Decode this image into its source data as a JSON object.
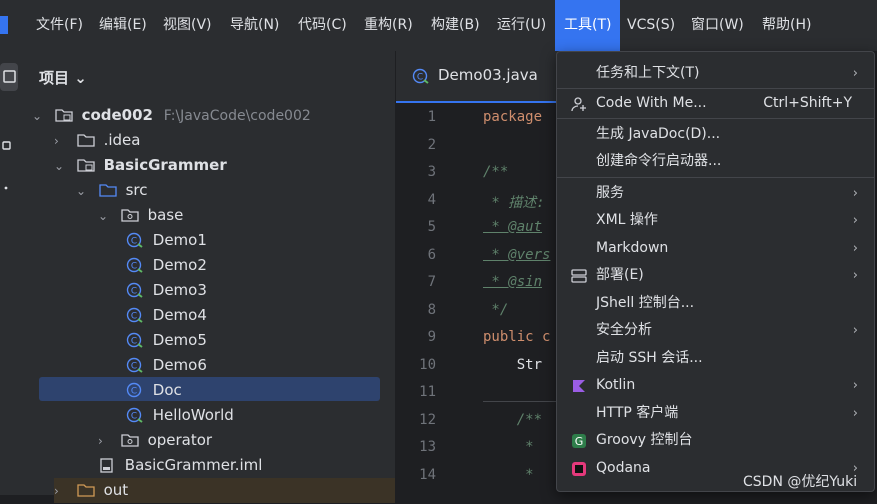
{
  "menubar": {
    "items": [
      "文件(F)",
      "编辑(E)",
      "视图(V)",
      "导航(N)",
      "代码(C)",
      "重构(R)",
      "构建(B)",
      "运行(U)",
      "工具(T)",
      "VCS(S)",
      "窗口(W)",
      "帮助(H)"
    ],
    "active_index": 8
  },
  "project": {
    "header": "项目 ⌄",
    "tree": [
      {
        "label": "code002",
        "path": "F:\\JavaCode\\code002",
        "bold": true
      },
      {
        "label": ".idea"
      },
      {
        "label": "BasicGrammer",
        "bold": true
      },
      {
        "label": "src"
      },
      {
        "label": "base"
      },
      {
        "label": "Demo1"
      },
      {
        "label": "Demo2"
      },
      {
        "label": "Demo3"
      },
      {
        "label": "Demo4"
      },
      {
        "label": "Demo5"
      },
      {
        "label": "Demo6"
      },
      {
        "label": "Doc"
      },
      {
        "label": "HelloWorld"
      },
      {
        "label": "operator"
      },
      {
        "label": "BasicGrammer.iml"
      },
      {
        "label": "out"
      }
    ]
  },
  "editor": {
    "tab_label": "Demo03.java",
    "line_numbers": [
      "1",
      "2",
      "3",
      "4",
      "5",
      "6",
      "7",
      "8",
      "9",
      "10",
      "11",
      "12",
      "13",
      "14"
    ],
    "lines": [
      "package",
      "",
      "/**",
      " * 描述:",
      " * @aut",
      " * @vers",
      " * @sin",
      " */",
      "public c",
      "    Str",
      "",
      "    /**",
      "     * ",
      "     * "
    ]
  },
  "tools_menu": {
    "items": [
      {
        "label": "任务和上下文(T)",
        "submenu": true
      },
      {
        "label": "Code With Me...",
        "shortcut": "Ctrl+Shift+Y",
        "icon": "user-add-icon"
      },
      {
        "label": "生成 JavaDoc(D)..."
      },
      {
        "label": "创建命令行启动器..."
      },
      {
        "label": "服务",
        "submenu": true
      },
      {
        "label": "XML 操作",
        "submenu": true
      },
      {
        "label": "Markdown",
        "submenu": true
      },
      {
        "label": "部署(E)",
        "submenu": true,
        "icon": "deploy-icon"
      },
      {
        "label": "JShell 控制台..."
      },
      {
        "label": "安全分析",
        "submenu": true
      },
      {
        "label": "启动 SSH 会话..."
      },
      {
        "label": "Kotlin",
        "submenu": true,
        "icon": "kotlin-icon"
      },
      {
        "label": "HTTP 客户端",
        "submenu": true
      },
      {
        "label": "Groovy 控制台",
        "icon": "groovy-icon"
      },
      {
        "label": "Qodana",
        "submenu": true,
        "icon": "qodana-icon"
      }
    ]
  },
  "watermark": "CSDN @优纪Yuki",
  "colors": {
    "accent": "#3574f0",
    "panel": "#2b2d30",
    "editor_bg": "#1e1f22"
  }
}
